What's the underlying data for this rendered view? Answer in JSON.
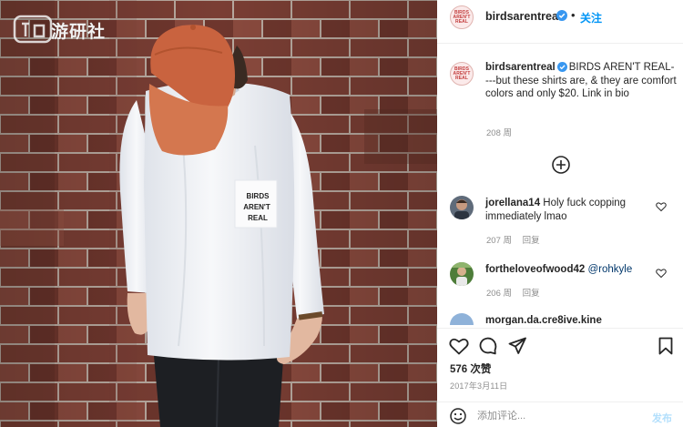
{
  "photo": {
    "shirt_print": [
      "BIRDS",
      "AREN'T",
      "REAL"
    ],
    "watermark_text": "游研社",
    "colors": {
      "brick": "#7d4238",
      "mortar": "#b9aba2",
      "shirt": "#f4f5f7",
      "cap": "#c9633f",
      "pants": "#1d1f23"
    }
  },
  "header": {
    "username": "birdsarentreal",
    "verified_icon": "verified-badge-icon",
    "dot": "•",
    "follow_label": "关注",
    "avatar_text": [
      "BIRDS",
      "AREN'T",
      "REAL"
    ]
  },
  "caption": {
    "username": "birdsarentreal",
    "text": "BIRDS AREN'T REAL----but these shirts are, & they are comfort colors and only $20. Link in bio",
    "time": "208 周"
  },
  "load_more_icon": "plus-circle-icon",
  "comments": [
    {
      "username": "jorellana14",
      "text": "Holy fuck copping immediately lmao",
      "time": "207 周",
      "reply": "回复"
    },
    {
      "username": "fortheloveofwood42",
      "mention": "@rohkyle",
      "time": "206 周",
      "reply": "回复"
    },
    {
      "username": "morgan.da.cre8ive.kine"
    }
  ],
  "actions": {
    "icons": [
      "heart-icon",
      "comment-icon",
      "share-icon",
      "bookmark-icon"
    ],
    "likes": "576 次赞",
    "date": "2017年3月11日"
  },
  "comment_bar": {
    "placeholder": "添加评论...",
    "post_label": "发布",
    "emoji_icon": "emoji-icon"
  },
  "accent": {
    "link_blue": "#0095f6",
    "post_disabled": "#b2dffc",
    "secondary_text": "#8e8e8e"
  }
}
